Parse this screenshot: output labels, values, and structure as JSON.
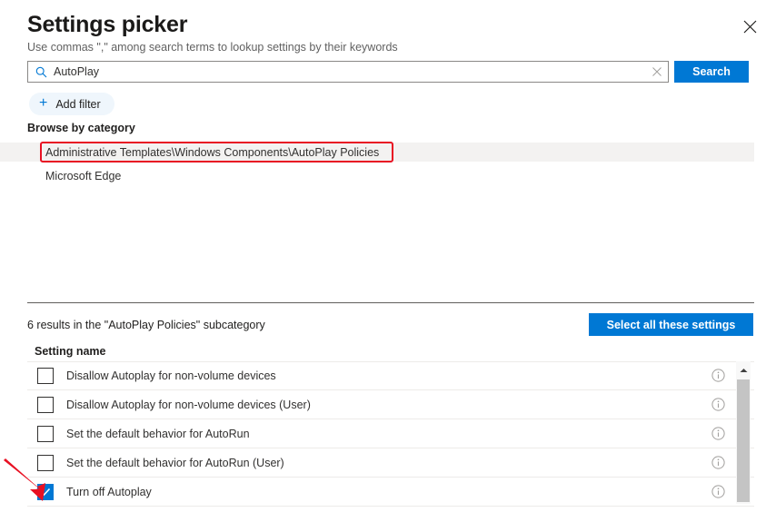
{
  "panel": {
    "title": "Settings picker",
    "subtitle": "Use commas \",\" among search terms to lookup settings by their keywords",
    "close_icon": "close-icon"
  },
  "search": {
    "value": "AutoPlay",
    "placeholder": "Search",
    "search_icon": "search-icon",
    "clear_icon": "clear-icon",
    "button_label": "Search"
  },
  "filters": {
    "add_filter_label": "Add filter",
    "plus_icon": "plus-icon"
  },
  "browse": {
    "label": "Browse by category",
    "categories": [
      {
        "label": "Administrative Templates\\Windows Components\\AutoPlay Policies",
        "selected": true
      },
      {
        "label": "Microsoft Edge",
        "selected": false
      }
    ]
  },
  "results": {
    "count_text": "6 results in the \"AutoPlay Policies\" subcategory",
    "select_all_label": "Select all these settings",
    "column_header": "Setting name",
    "rows": [
      {
        "label": "Disallow Autoplay for non-volume devices",
        "checked": false,
        "info_icon": "info-icon"
      },
      {
        "label": "Disallow Autoplay for non-volume devices (User)",
        "checked": false,
        "info_icon": "info-icon"
      },
      {
        "label": "Set the default behavior for AutoRun",
        "checked": false,
        "info_icon": "info-icon"
      },
      {
        "label": "Set the default behavior for AutoRun (User)",
        "checked": false,
        "info_icon": "info-icon"
      },
      {
        "label": "Turn off Autoplay",
        "checked": true,
        "info_icon": "info-icon"
      }
    ]
  },
  "scrollbar": {
    "up_arrow_icon": "chevron-up-icon"
  },
  "annotations": {
    "highlight_box_color": "#e81123",
    "arrow_color": "#e81123"
  },
  "colors": {
    "accent": "#0078d4",
    "selected_row": "#f3f2f1",
    "divider": "#605e5c"
  }
}
